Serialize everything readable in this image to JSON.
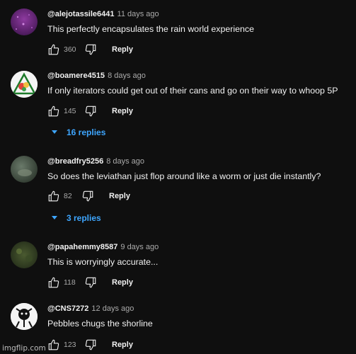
{
  "comments": [
    {
      "username": "@alejotassile6441",
      "time": "11 days ago",
      "text": "This perfectly encapsulates the rain world experience",
      "likes": "360",
      "reply_label": "Reply",
      "avatar_color": "#6b2e7a"
    },
    {
      "username": "@boamere4515",
      "time": "8 days ago",
      "text": "If only iterators could get out of their cans and go on their way to whoop 5P",
      "likes": "145",
      "reply_label": "Reply",
      "replies_label": "16 replies",
      "avatar_color": "#f4f4f4"
    },
    {
      "username": "@breadfry5256",
      "time": "8 days ago",
      "text": "So does the leviathan just flop around like a worm or just die instantly?",
      "likes": "82",
      "reply_label": "Reply",
      "replies_label": "3 replies",
      "avatar_color": "#4a5a4a"
    },
    {
      "username": "@papahemmy8587",
      "time": "9 days ago",
      "text": "This is worryingly accurate...",
      "likes": "118",
      "reply_label": "Reply",
      "avatar_color": "#2d3a22"
    },
    {
      "username": "@CNS7272",
      "time": "12 days ago",
      "text": "Pebbles chugs the shorline",
      "likes": "123",
      "reply_label": "Reply",
      "avatar_color": "#f4f4f4"
    }
  ],
  "watermark": "imgflip.com",
  "colors": {
    "background": "#0f0f0f",
    "link": "#3ea6ff",
    "muted": "#aaaaaa"
  },
  "icons": [
    "thumbs-up-icon",
    "thumbs-down-icon",
    "chevron-down-icon"
  ]
}
